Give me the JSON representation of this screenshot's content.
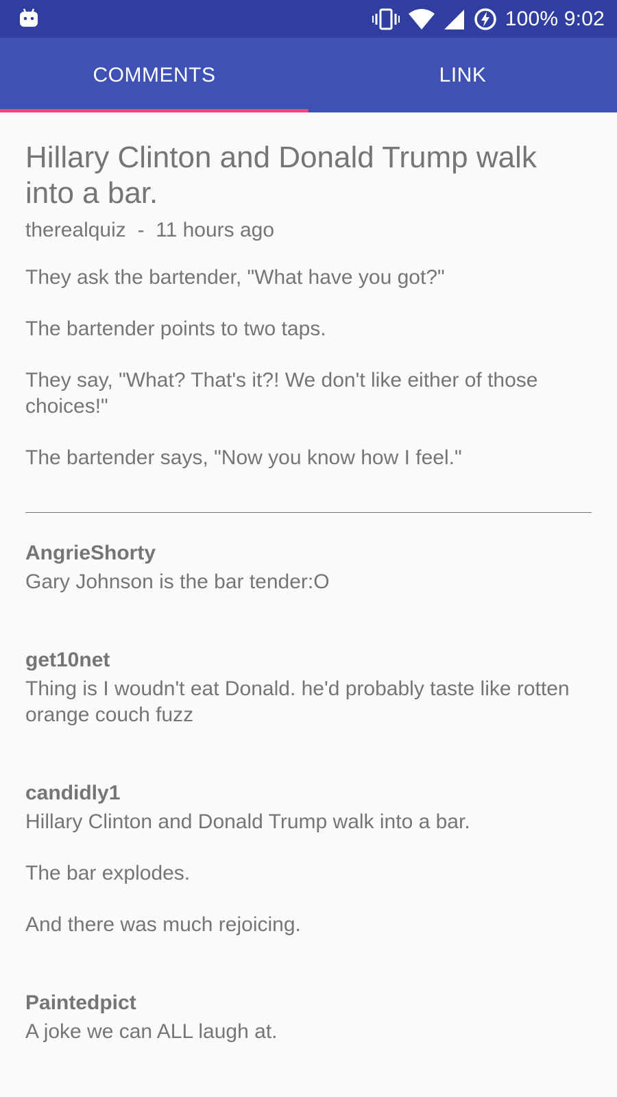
{
  "status_bar": {
    "battery": "100%",
    "time": "9:02"
  },
  "tabs": [
    {
      "label": "COMMENTS",
      "active": true
    },
    {
      "label": "LINK",
      "active": false
    }
  ],
  "post": {
    "title": "Hillary Clinton and Donald Trump walk into a bar.",
    "author": "therealquiz",
    "separator": "-",
    "time": "11 hours ago",
    "paragraphs": [
      "They ask the bartender, \"What have you got?\"",
      "The bartender points to two taps.",
      "They say, \"What? That's it?! We don't like either of those choices!\"",
      "The bartender says, \"Now you know how I feel.\""
    ]
  },
  "comments": [
    {
      "author": "AngrieShorty",
      "paragraphs": [
        "Gary Johnson is the bar tender:O"
      ]
    },
    {
      "author": "get10net",
      "paragraphs": [
        "Thing is I woudn't eat Donald. he'd probably taste like rotten orange couch fuzz"
      ]
    },
    {
      "author": "candidly1",
      "paragraphs": [
        "Hillary Clinton and Donald Trump walk into a bar.",
        "The bar explodes.",
        "And there was much rejoicing."
      ]
    },
    {
      "author": "Paintedpict",
      "paragraphs": [
        "A joke we can ALL laugh at."
      ]
    }
  ],
  "colors": {
    "status_bar": "#303f9f",
    "app_bar": "#3f51b5",
    "tab_indicator": "#ff4081",
    "text": "#757575"
  }
}
